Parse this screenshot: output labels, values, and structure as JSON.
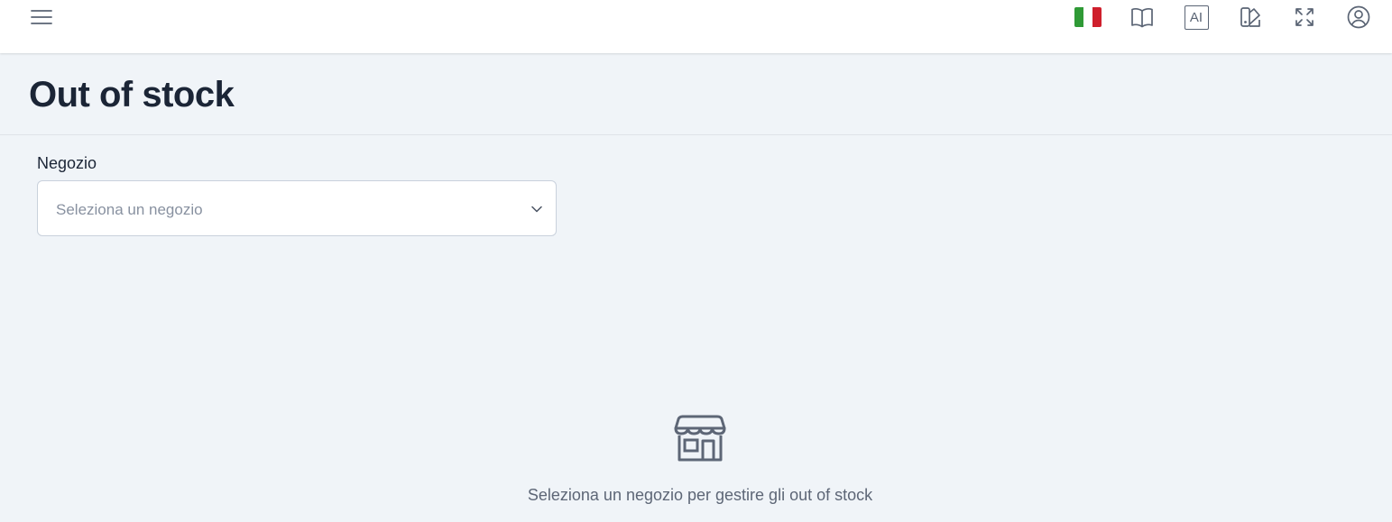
{
  "topbar": {
    "menu_icon": "hamburger-menu-icon",
    "language_flag": {
      "icon": "italy-flag-icon",
      "colors": [
        "#2f9a36",
        "#ffffff",
        "#cf1f2c"
      ]
    },
    "icons": [
      "book-open-icon",
      "ai-icon",
      "palette-icon",
      "fullscreen-icon",
      "user-circle-icon"
    ],
    "ai_label": "AI"
  },
  "header": {
    "title": "Out of stock"
  },
  "store_field": {
    "label": "Negozio",
    "placeholder": "Seleziona un negozio"
  },
  "empty_state": {
    "icon": "store-icon",
    "message": "Seleziona un negozio per gestire gli out of stock"
  },
  "colors": {
    "background": "#f0f4f8",
    "topbar": "#ffffff",
    "title": "#1b2536",
    "icon": "#5a6474",
    "placeholder": "#8891a0"
  }
}
